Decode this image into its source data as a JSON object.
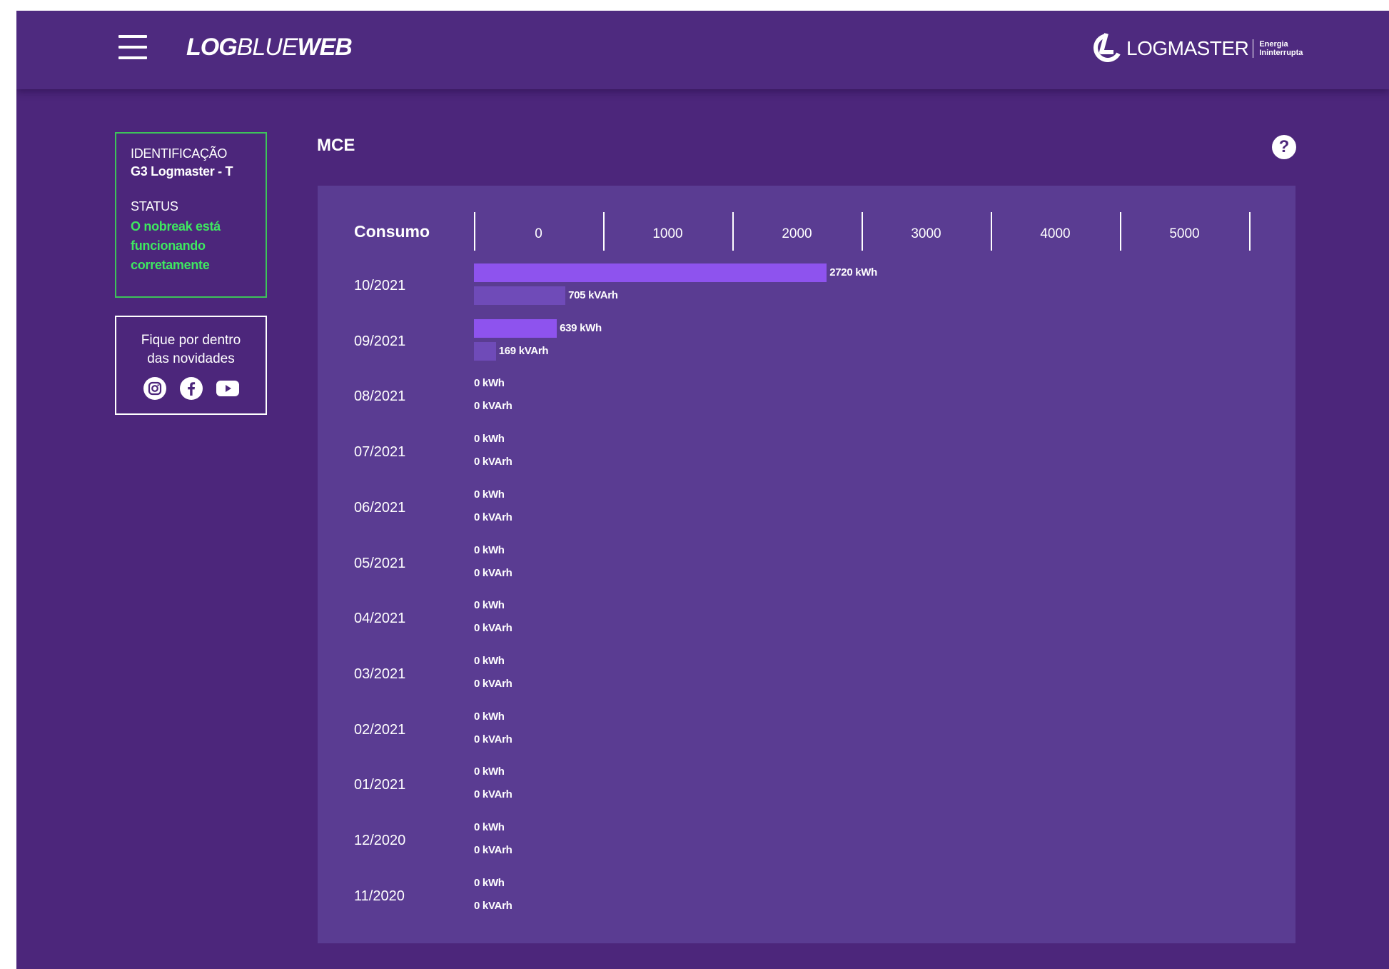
{
  "header": {
    "logo_bold_1": "LOG",
    "logo_light": "BLUE",
    "logo_bold_2": "WEB",
    "brand_name": "LOGMASTER",
    "brand_tag_1": "Energia",
    "brand_tag_2": "Ininterrupta",
    "menu_icon": "hamburger-icon"
  },
  "sidebar": {
    "identificacao_label": "IDENTIFICAÇÃO",
    "identificacao_value": "G3 Logmaster - T",
    "status_label": "STATUS",
    "status_value": "O nobreak está funcionando corretamente",
    "status_color": "#3ee860",
    "social_text": "Fique por dentro das novidades",
    "social_icons": [
      "instagram-icon",
      "facebook-icon",
      "youtube-icon"
    ]
  },
  "main": {
    "title": "MCE",
    "help_icon": "?"
  },
  "colors": {
    "background": "#4c267b",
    "panel": "#5a3c92",
    "kwh_bar": "#8e53ee",
    "kvarh_bar": "#6f4bb8",
    "card_border": "#3dc35a"
  },
  "chart_data": {
    "type": "bar",
    "orientation": "horizontal",
    "title": "Consumo",
    "xlim": [
      0,
      5000
    ],
    "ticks": [
      0,
      1000,
      2000,
      3000,
      4000,
      5000
    ],
    "categories": [
      "10/2021",
      "09/2021",
      "08/2021",
      "07/2021",
      "06/2021",
      "05/2021",
      "04/2021",
      "03/2021",
      "02/2021",
      "01/2021",
      "12/2020",
      "11/2020"
    ],
    "series": [
      {
        "unit": "kWh",
        "values": [
          2720,
          639,
          0,
          0,
          0,
          0,
          0,
          0,
          0,
          0,
          0,
          0
        ]
      },
      {
        "unit": "kVArh",
        "values": [
          705,
          169,
          0,
          0,
          0,
          0,
          0,
          0,
          0,
          0,
          0,
          0
        ]
      }
    ]
  }
}
